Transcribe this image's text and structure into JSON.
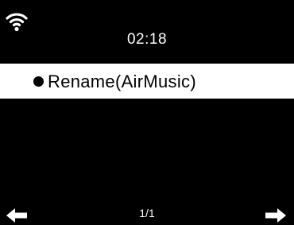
{
  "status_bar": {
    "time": "02:18",
    "wifi_icon": "wifi-icon"
  },
  "menu": {
    "items": [
      {
        "label": "Rename(AirMusic)",
        "selected": true,
        "bullet_icon": "bullet-icon"
      }
    ]
  },
  "footer": {
    "page_indicator": "1/1",
    "left_icon": "arrow-left-icon",
    "right_icon": "arrow-right-icon"
  },
  "colors": {
    "background": "#000000",
    "text": "#ffffff",
    "highlight_background": "#ffffff",
    "highlight_text": "#000000"
  }
}
